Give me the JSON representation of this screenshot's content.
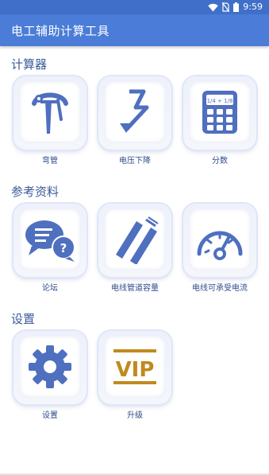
{
  "status_bar": {
    "time": "9:59"
  },
  "app": {
    "title": "电工辅助计算工具"
  },
  "sections": {
    "calculator": {
      "title": "计算器",
      "items": [
        {
          "label": "弯管"
        },
        {
          "label": "电压下降"
        },
        {
          "label": "分数"
        }
      ]
    },
    "reference": {
      "title": "参考资料",
      "items": [
        {
          "label": "论坛"
        },
        {
          "label": "电线管道容量"
        },
        {
          "label": "电线可承受电流"
        }
      ]
    },
    "settings": {
      "title": "设置",
      "items": [
        {
          "label": "设置"
        },
        {
          "label": "升级"
        }
      ]
    }
  },
  "icons": {
    "vip_text": "VIP",
    "fraction_top": "1/4 + 1/8",
    "forum_question": "?"
  },
  "colors": {
    "app_bar": "#4A7CD8",
    "status_bar": "#3F6FC8",
    "icon_blue": "#4F6FBF",
    "vip_gold": "#C08A1E"
  }
}
